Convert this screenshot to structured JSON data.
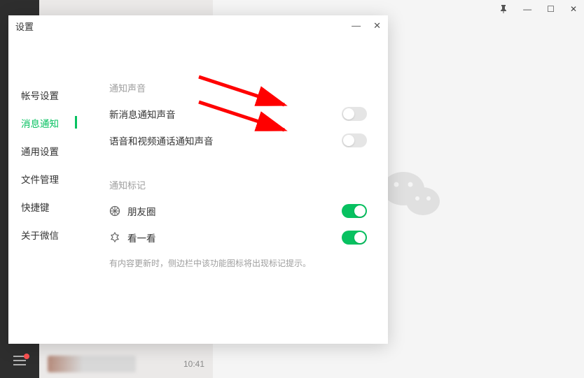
{
  "window": {
    "pin_icon": "📌",
    "minimize": "—",
    "maximize": "☐",
    "close": "✕"
  },
  "chat_list": {
    "time": "10:41"
  },
  "settings": {
    "title": "设置",
    "dialog_minimize": "—",
    "dialog_close": "✕",
    "nav": [
      {
        "label": "帐号设置"
      },
      {
        "label": "消息通知",
        "active": true
      },
      {
        "label": "通用设置"
      },
      {
        "label": "文件管理"
      },
      {
        "label": "快捷键"
      },
      {
        "label": "关于微信"
      }
    ],
    "section1_title": "通知声音",
    "row1_label": "新消息通知声音",
    "row1_state": "off",
    "row2_label": "语音和视频通话通知声音",
    "row2_state": "off",
    "section2_title": "通知标记",
    "row3_label": "朋友圈",
    "row3_state": "on",
    "row4_label": "看一看",
    "row4_state": "on",
    "hint": "有内容更新时，侧边栏中该功能图标将出现标记提示。"
  }
}
